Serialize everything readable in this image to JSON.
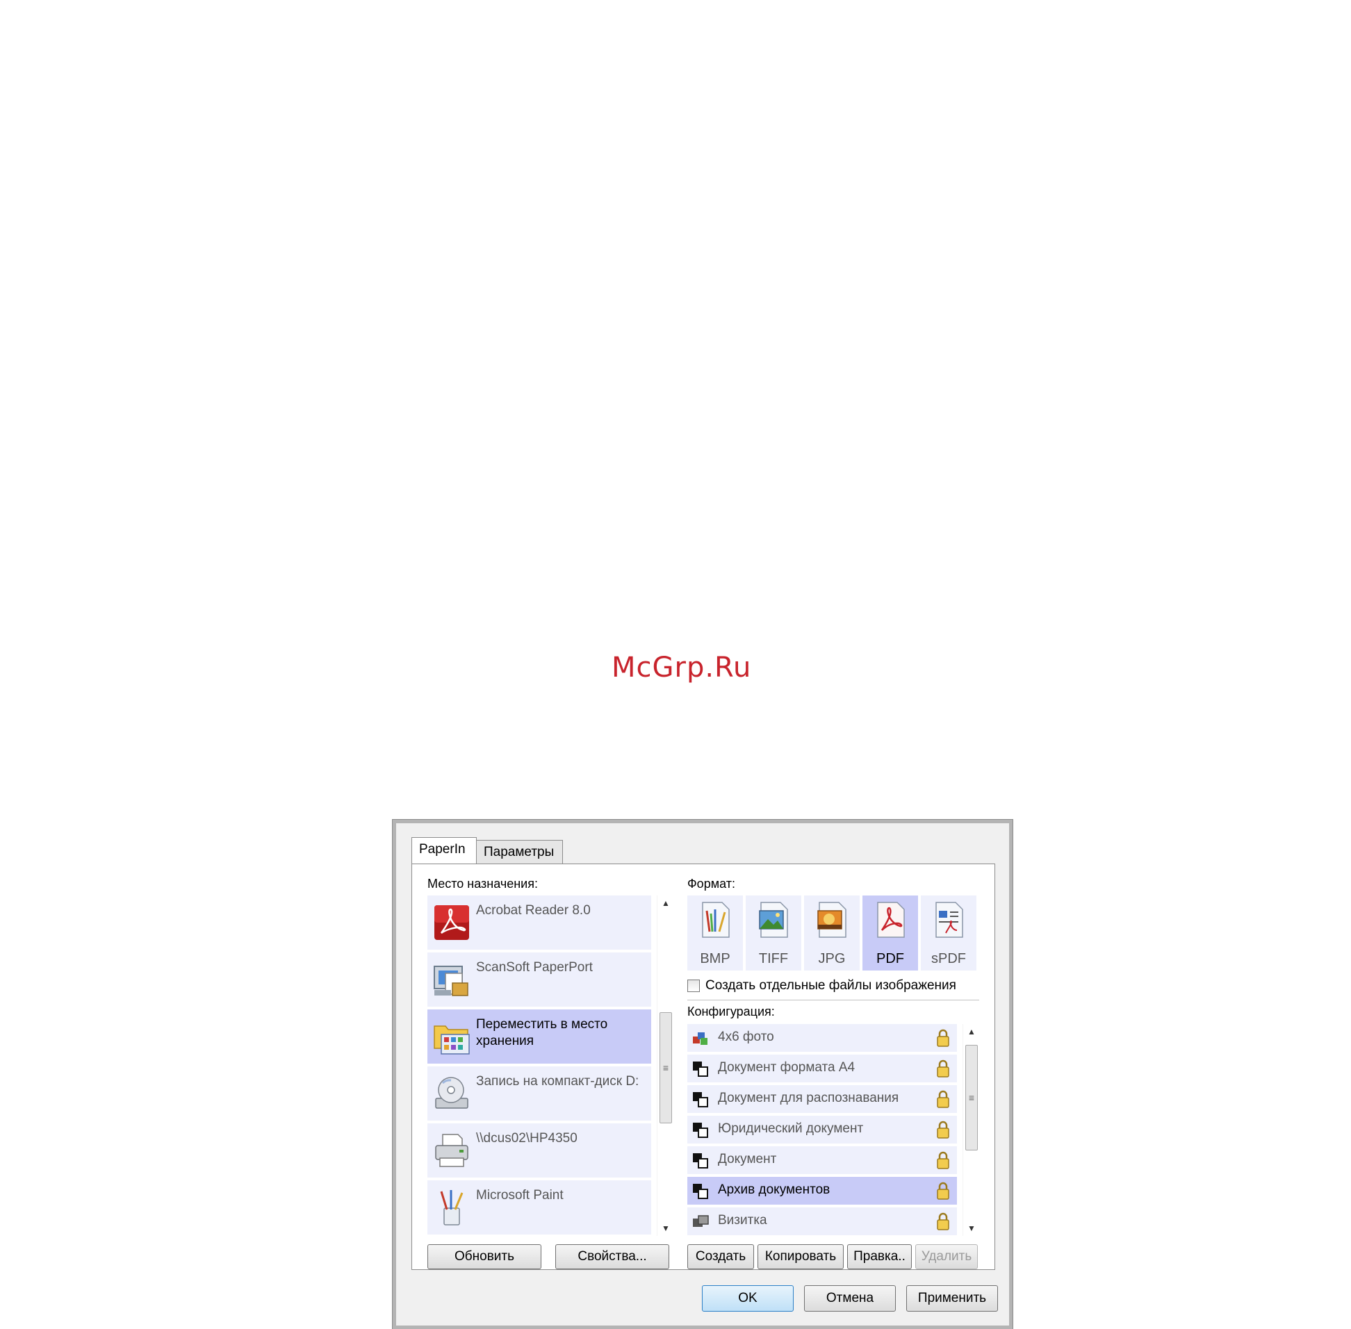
{
  "watermark": "McGrp.Ru",
  "tabs": [
    {
      "label": "PaperIn",
      "active": true
    },
    {
      "label": "Параметры",
      "active": false
    }
  ],
  "destination": {
    "label": "Место назначения:",
    "items": [
      {
        "label": "Acrobat Reader 8.0",
        "icon": "acrobat-icon",
        "selected": false
      },
      {
        "label": "ScanSoft PaperPort",
        "icon": "paperport-icon",
        "selected": false
      },
      {
        "label": "Переместить в место хранения",
        "icon": "folder-icon",
        "selected": true
      },
      {
        "label": "Запись на компакт-диск D:",
        "icon": "cd-burner-icon",
        "selected": false
      },
      {
        "label": "\\\\dcus02\\HP4350",
        "icon": "printer-icon",
        "selected": false
      },
      {
        "label": "Microsoft Paint",
        "icon": "paint-icon",
        "selected": false
      }
    ],
    "refresh_label": "Обновить",
    "properties_label": "Свойства..."
  },
  "format": {
    "label": "Формат:",
    "items": [
      {
        "label": "BMP",
        "icon": "bmp-file-icon",
        "selected": false
      },
      {
        "label": "TIFF",
        "icon": "tiff-file-icon",
        "selected": false
      },
      {
        "label": "JPG",
        "icon": "jpg-file-icon",
        "selected": false
      },
      {
        "label": "PDF",
        "icon": "pdf-file-icon",
        "selected": true
      },
      {
        "label": "sPDF",
        "icon": "spdf-file-icon",
        "selected": false
      }
    ],
    "separate_files_label": "Создать отдельные файлы изображения",
    "separate_files_checked": false
  },
  "configuration": {
    "label": "Конфигурация:",
    "items": [
      {
        "label": "4x6 фото",
        "icon": "color-photo-icon",
        "selected": false
      },
      {
        "label": "Документ формата А4",
        "icon": "bw-document-icon",
        "selected": false
      },
      {
        "label": "Документ для распознавания",
        "icon": "bw-document-icon",
        "selected": false
      },
      {
        "label": "Юридический документ",
        "icon": "bw-document-icon",
        "selected": false
      },
      {
        "label": "Документ",
        "icon": "bw-document-icon",
        "selected": false
      },
      {
        "label": "Архив документов",
        "icon": "bw-document-icon",
        "selected": true
      },
      {
        "label": "Визитка",
        "icon": "gray-card-icon",
        "selected": false
      }
    ],
    "new_label": "Создать",
    "copy_label": "Копировать",
    "edit_label": "Правка..",
    "delete_label": "Удалить"
  },
  "footer": {
    "ok_label": "OK",
    "cancel_label": "Отмена",
    "apply_label": "Применить"
  },
  "colors": {
    "selection": "#c8cbf7",
    "item_background": "#eef0fc",
    "dialog_background": "#f0f0f0",
    "watermark": "#c8232c"
  }
}
